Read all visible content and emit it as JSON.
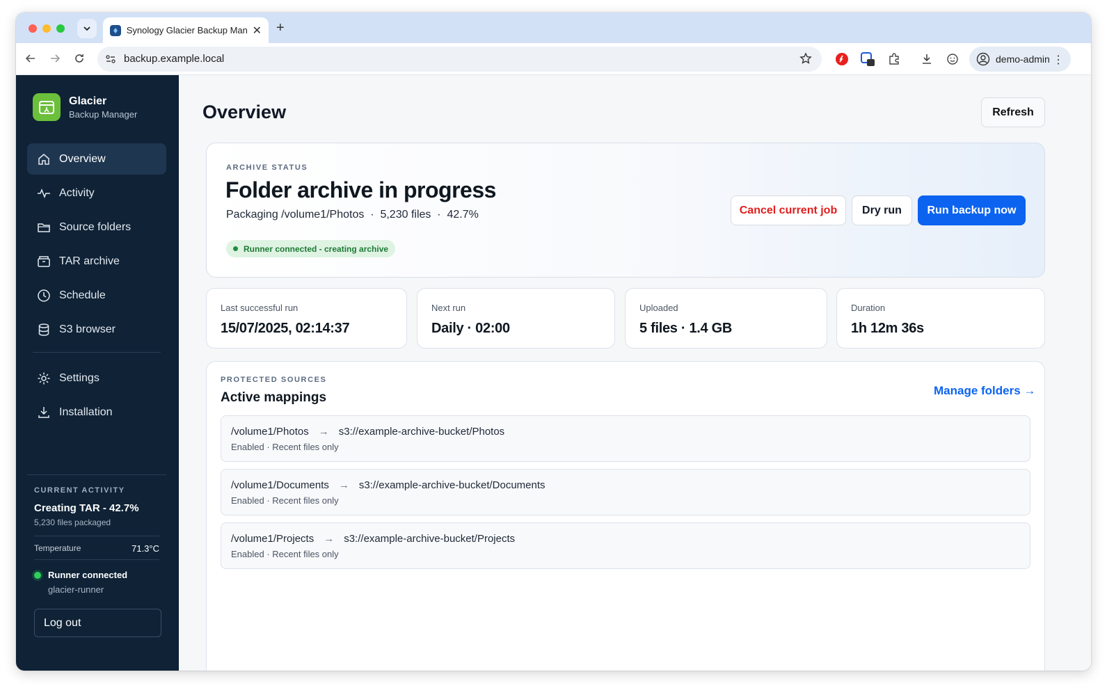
{
  "browser": {
    "tab_title": "Synology Glacier Backup Man",
    "url": "backup.example.local",
    "profile_name": "demo-admin"
  },
  "sidebar": {
    "brand_title": "Glacier",
    "brand_subtitle": "Backup Manager",
    "items": [
      {
        "label": "Overview",
        "icon": "home-icon",
        "active": true
      },
      {
        "label": "Activity",
        "icon": "activity-icon"
      },
      {
        "label": "Source folders",
        "icon": "folder-icon"
      },
      {
        "label": "TAR archive",
        "icon": "archive-icon"
      },
      {
        "label": "Schedule",
        "icon": "clock-icon"
      },
      {
        "label": "S3 browser",
        "icon": "database-icon"
      }
    ],
    "bottom_items": [
      {
        "label": "Settings",
        "icon": "gear-icon"
      },
      {
        "label": "Installation",
        "icon": "download-icon"
      }
    ],
    "activity": {
      "label": "CURRENT ACTIVITY",
      "title": "Creating TAR - 42.7%",
      "subtitle": "5,230 files packaged",
      "temperature_label": "Temperature",
      "temperature_value": "71.3°C",
      "runner_title": "Runner connected",
      "runner_name": "glacier-runner"
    },
    "logout_label": "Log out"
  },
  "main": {
    "title": "Overview",
    "refresh_label": "Refresh",
    "status": {
      "eyebrow": "ARCHIVE STATUS",
      "title": "Folder archive in progress",
      "detail": "Packaging /volume1/Photos  ·  5,230 files  ·  42.7%",
      "pill": "Runner connected - creating archive",
      "cancel_label": "Cancel current job",
      "dry_run_label": "Dry run",
      "run_label": "Run backup now"
    },
    "stats": [
      {
        "label": "Last successful run",
        "value": "15/07/2025, 02:14:37"
      },
      {
        "label": "Next run",
        "value": "Daily · 02:00"
      },
      {
        "label": "Uploaded",
        "value": "5 files · 1.4 GB"
      },
      {
        "label": "Duration",
        "value": "1h 12m 36s"
      }
    ],
    "sources": {
      "eyebrow": "PROTECTED SOURCES",
      "title": "Active mappings",
      "manage_label": "Manage folders →",
      "mappings": [
        {
          "source": "/volume1/Photos",
          "target": "s3://example-archive-bucket/Photos",
          "meta": "Enabled · Recent files only"
        },
        {
          "source": "/volume1/Documents",
          "target": "s3://example-archive-bucket/Documents",
          "meta": "Enabled · Recent files only"
        },
        {
          "source": "/volume1/Projects",
          "target": "s3://example-archive-bucket/Projects",
          "meta": "Enabled · Recent files only"
        }
      ]
    }
  },
  "colors": {
    "sidebar_bg": "#0f2236",
    "accent": "#0b63f0",
    "danger": "#e11d1d",
    "success": "#1e7a34"
  }
}
